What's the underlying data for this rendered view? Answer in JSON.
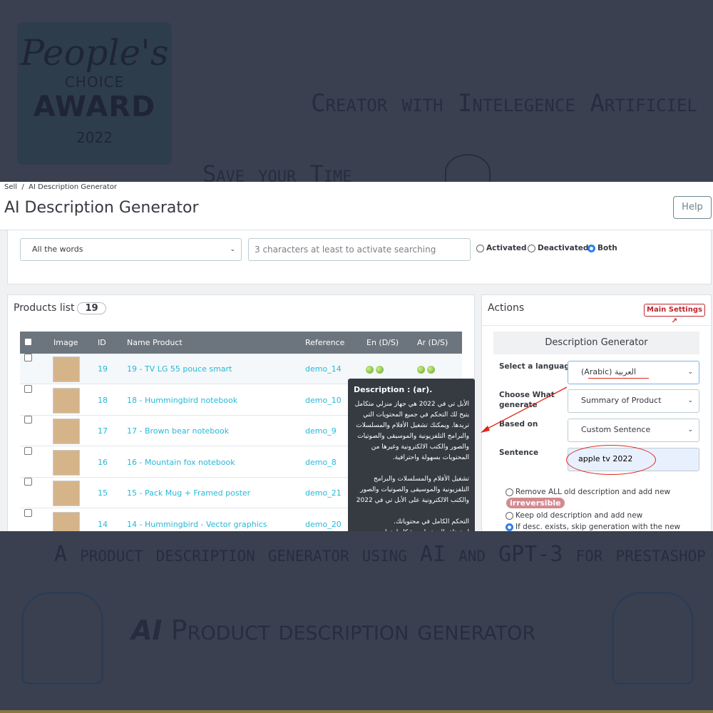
{
  "background": {
    "award": {
      "line1": "People's",
      "line2": "CHOICE",
      "line3": "AWARD",
      "line4": "2022"
    },
    "headline1": "Creator with Intelegence Artificiel",
    "headline2": "Save your Time",
    "tagline": "A product description generator using AI and GPT-3 for prestashop",
    "logo_ai": "AI",
    "logo_text": "Product description generator"
  },
  "app": {
    "breadcrumb": [
      "Sell",
      "AI Description Generator"
    ],
    "breadcrumb_sep": "/",
    "title": "AI Description Generator",
    "help_label": "Help",
    "filter": {
      "match_value": "All the words",
      "search_placeholder": "3 characters at least to activate searching",
      "status_options": [
        "Activated",
        "Deactivated",
        "Both"
      ],
      "status_selected": "Both"
    },
    "products": {
      "title": "Products list",
      "count": "19",
      "columns": [
        "Image",
        "ID",
        "Name Product",
        "Reference",
        "En (D/S)",
        "Ar (D/S)"
      ],
      "rows": [
        {
          "id": "19",
          "name": "19 - TV LG 55 pouce smart",
          "ref": "demo_14"
        },
        {
          "id": "18",
          "name": "18 - Hummingbird notebook",
          "ref": "demo_10"
        },
        {
          "id": "17",
          "name": "17 - Brown bear notebook",
          "ref": "demo_9"
        },
        {
          "id": "16",
          "name": "16 - Mountain fox notebook",
          "ref": "demo_8"
        },
        {
          "id": "15",
          "name": "15 - Pack Mug + Framed poster",
          "ref": "demo_21"
        },
        {
          "id": "14",
          "name": "14 - Hummingbird - Vector graphics",
          "ref": "demo_20"
        }
      ]
    },
    "tooltip": {
      "title": "Description : (ar).",
      "body": "الأبل تي في 2022 هي جهاز منزلي متكامل يتيح لك التحكم في جميع المحتويات التي تريدها. ويمكنك تشغيل الأفلام والمسلسلات والبرامج التلفزيونية والموسيقى والصوتيات والصور والكتب الالكترونية وغيرها من المحتويات بسهولة واحترافية.\n\nتشغيل الأفلام والمسلسلات والبرامج التلفزيونية والموسيقى والصوتيات والصور والكتب الالكترونية على الأبل تي في 2022\n\nالتحكم الكامل في محتوياتك.\nاستمتاع بالمحتويات بشكل احترا."
    },
    "actions": {
      "title": "Actions",
      "main_settings": "Main Settings",
      "section_title": "Description Generator",
      "language_label": "Select a language",
      "language_value": "(Arabic) العربية",
      "what_label": "Choose What generate",
      "what_value": "Summary of Product",
      "based_label": "Based on",
      "based_value": "Custom Sentence",
      "sentence_label": "Sentence",
      "sentence_value": "apple tv 2022",
      "options": [
        "Remove ALL old description and add new",
        "Keep old description and add new",
        "If desc. exists, skip generation with the new"
      ],
      "irreversible": "irreversible",
      "selected_option": 2
    },
    "annotation_color": "#e0261b"
  }
}
